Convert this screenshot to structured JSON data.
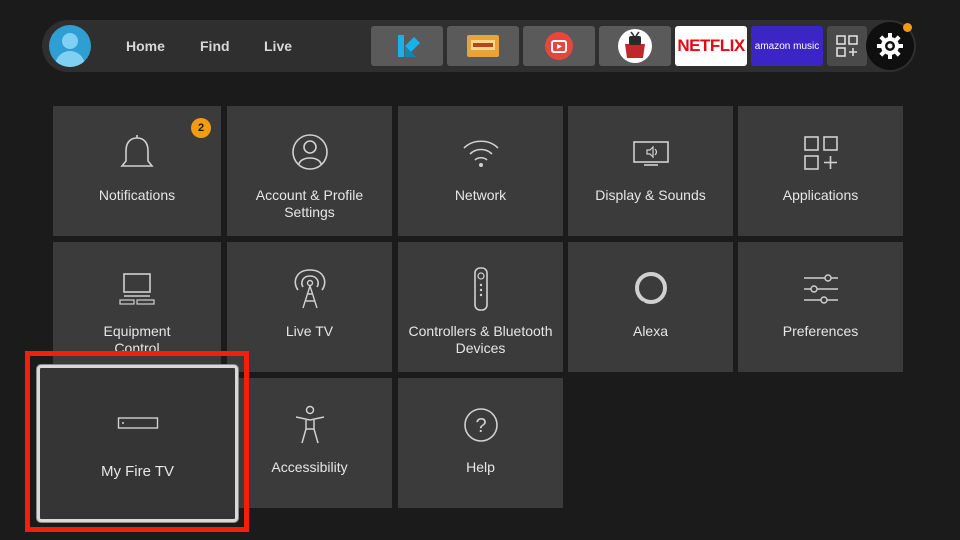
{
  "nav": {
    "links": [
      "Home",
      "Find",
      "Live"
    ],
    "apps": [
      {
        "name": "kodi-icon"
      },
      {
        "name": "cinema-hd-icon"
      },
      {
        "name": "tv-app-icon"
      },
      {
        "name": "redbox-tv-icon"
      },
      {
        "name": "netflix-logo",
        "text": "NETFLIX"
      },
      {
        "name": "amazon-music-logo",
        "text": "amazon music"
      },
      {
        "name": "all-apps-grid-icon"
      }
    ],
    "settings_icon": "gear-icon"
  },
  "settings": {
    "tiles": [
      {
        "label": "Notifications",
        "icon": "bell-icon",
        "badge": "2"
      },
      {
        "label": "Account & Profile Settings",
        "icon": "user-circle-icon"
      },
      {
        "label": "Network",
        "icon": "wifi-icon"
      },
      {
        "label": "Display & Sounds",
        "icon": "monitor-speaker-icon"
      },
      {
        "label": "Applications",
        "icon": "apps-grid-icon"
      },
      {
        "label": "Equipment Control",
        "icon": "laptop-icon"
      },
      {
        "label": "Live TV",
        "icon": "antenna-icon"
      },
      {
        "label": "Controllers & Bluetooth Devices",
        "icon": "remote-icon"
      },
      {
        "label": "Alexa",
        "icon": "alexa-ring-icon"
      },
      {
        "label": "Preferences",
        "icon": "sliders-icon"
      },
      {
        "label": "My Fire TV",
        "icon": "fire-tv-device-icon",
        "focused": true
      },
      {
        "label": "Accessibility",
        "icon": "accessibility-icon"
      },
      {
        "label": "Help",
        "icon": "help-icon"
      }
    ]
  },
  "colors": {
    "accent_orange": "#f39c12",
    "highlight_red": "#f41f0b",
    "tile_bg": "#3b3b3b"
  }
}
